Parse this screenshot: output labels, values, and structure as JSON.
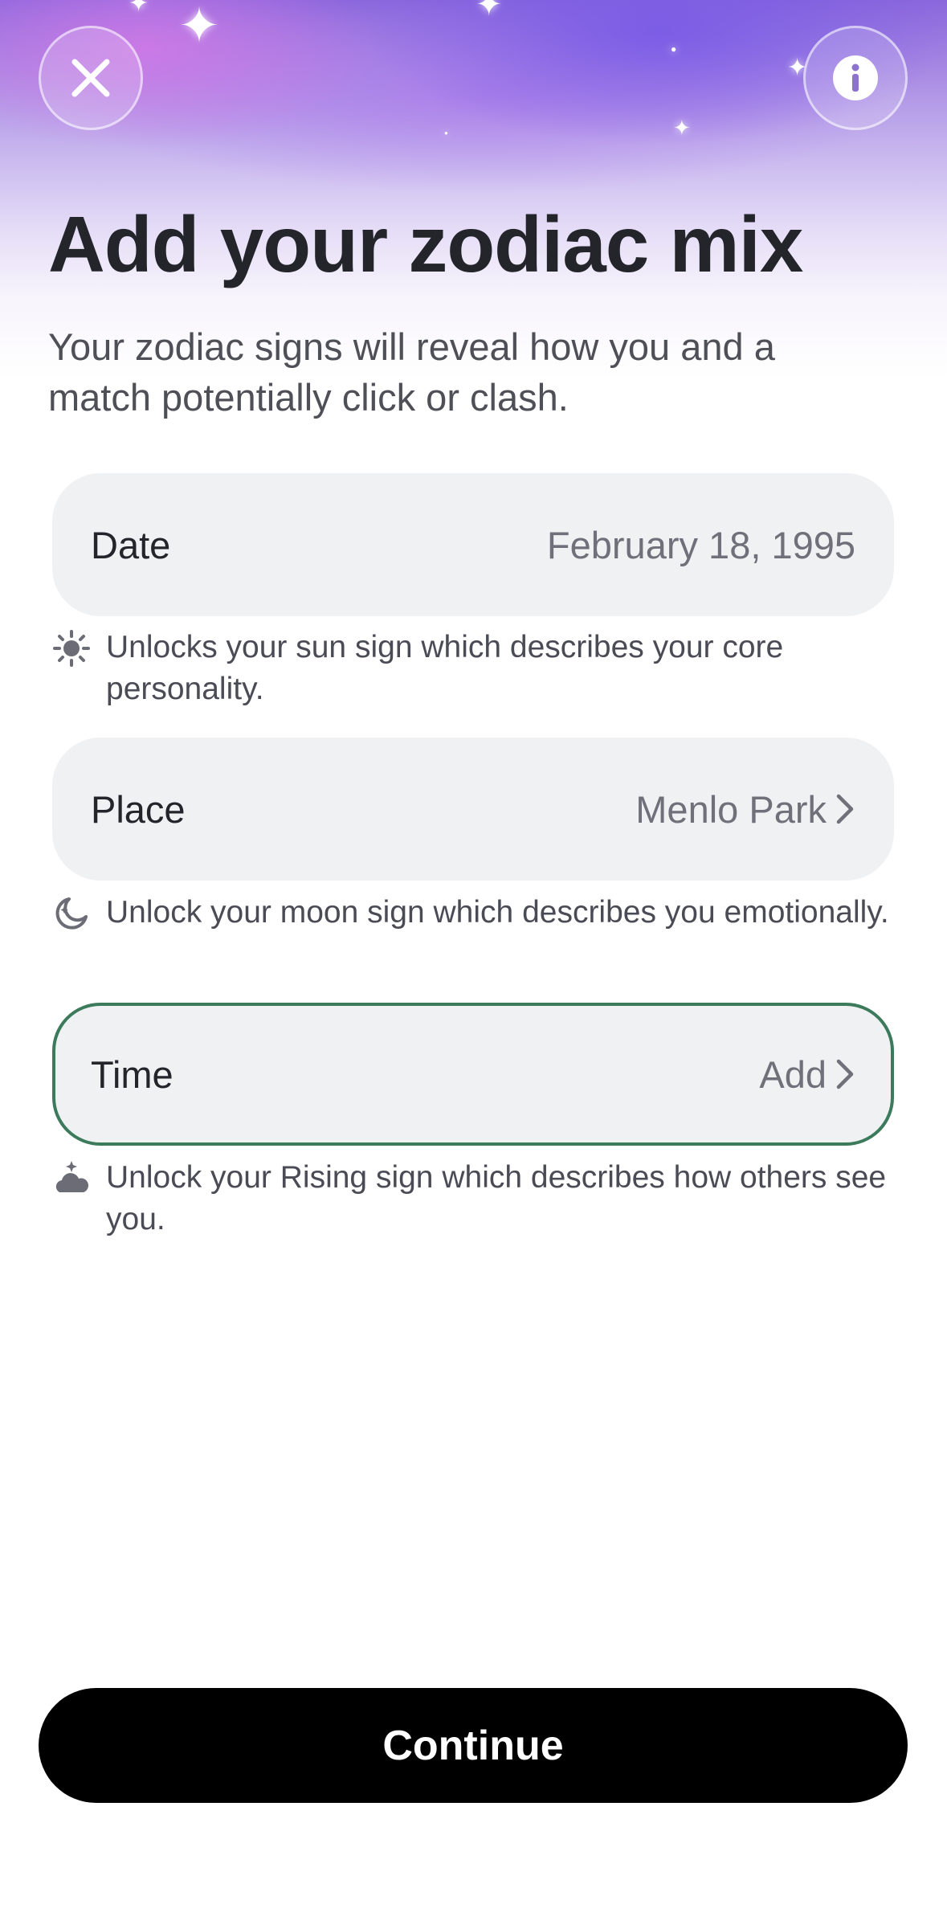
{
  "header": {
    "title": "Add your zodiac mix",
    "subtitle": "Your zodiac signs will reveal how you and a match potentially click or clash.",
    "close_icon": "close-icon",
    "info_icon": "info-icon"
  },
  "fields": [
    {
      "label": "Date",
      "value": "February 18, 1995",
      "hint": "Unlocks your sun sign which describes your core personality.",
      "hint_icon": "sun-icon"
    },
    {
      "label": "Place",
      "value": "Menlo Park",
      "hint": "Unlock your moon sign which describes you emotionally.",
      "hint_icon": "moon-icon"
    },
    {
      "label": "Time",
      "value": "Add",
      "hint": "Unlock your Rising sign which describes how others see you.",
      "hint_icon": "rising-sun-cloud-icon"
    }
  ],
  "footer": {
    "continue_label": "Continue"
  },
  "colors": {
    "active_border": "#3b7a5b",
    "button_bg": "#000000",
    "field_bg": "#f0f1f3"
  }
}
